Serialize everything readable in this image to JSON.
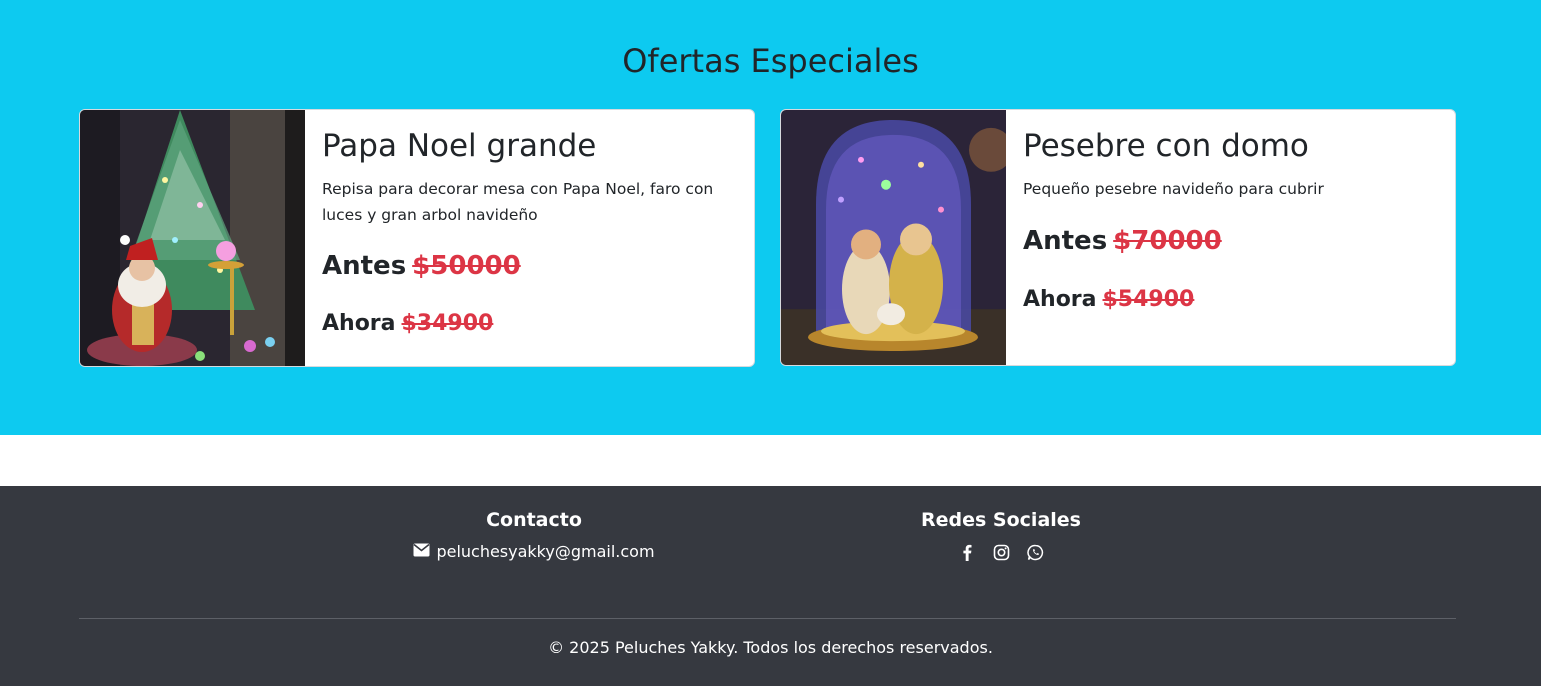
{
  "offers": {
    "title": "Ofertas Especiales",
    "background_color": "#0dcaf0",
    "items": [
      {
        "title": "Papa Noel grande",
        "description": "Repisa para decorar mesa con Papa Noel, faro con luces y gran arbol navideño",
        "before_label": "Antes",
        "before_price": "$50000",
        "now_label": "Ahora",
        "now_price": "$34900",
        "image": "santa-claus-with-christmas-tree-photo"
      },
      {
        "title": "Pesebre con domo",
        "description": "Pequeño pesebre navideño para cubrir",
        "before_label": "Antes",
        "before_price": "$70000",
        "now_label": "Ahora",
        "now_price": "$54900",
        "image": "nativity-scene-glass-dome-photo"
      }
    ],
    "price_color": "#dc3545"
  },
  "footer": {
    "background_color": "#363940",
    "contact": {
      "heading": "Contacto",
      "email_icon": "envelope-icon",
      "email": "peluchesyakky@gmail.com"
    },
    "social": {
      "heading": "Redes Sociales",
      "icons": [
        "facebook-icon",
        "instagram-icon",
        "whatsapp-icon"
      ]
    },
    "copyright": "© 2025 Peluches Yakky. Todos los derechos reservados."
  }
}
